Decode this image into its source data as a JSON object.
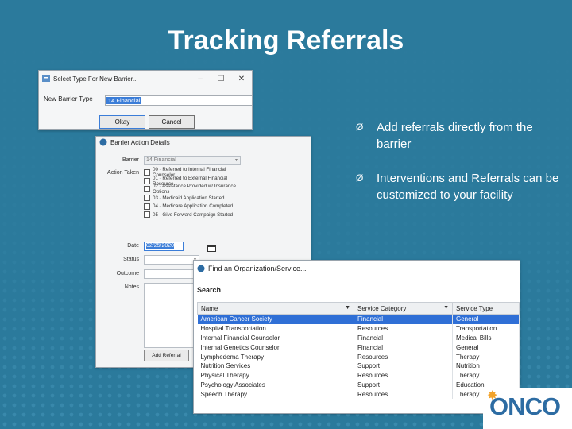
{
  "slide": {
    "title": "Tracking Referrals",
    "bullets": [
      "Add referrals directly from the barrier",
      "Interventions and Referrals can be customized to your facility"
    ],
    "bullet_marker": "Ø"
  },
  "dialog_select_type": {
    "title": "Select Type For New Barrier...",
    "field_label": "New Barrier Type",
    "field_value": "14 Financial",
    "ok_label": "Okay",
    "cancel_label": "Cancel"
  },
  "dialog_barrier_action": {
    "title": "Barrier Action Details",
    "barrier_label": "Barrier",
    "barrier_value": "14 Financial",
    "action_label": "Action Taken",
    "actions": [
      "00 - Referred to Internal Financial Counselor",
      "01 - Referred to External Financial Resource",
      "02 - Assistance Provided w/ Insurance Options",
      "03 - Medicaid Application Started",
      "04 - Medicare Application Completed",
      "05 - Give Forward Campaign Started"
    ],
    "date_label": "Date",
    "date_value": "02/25/2020",
    "status_label": "Status",
    "outcome_label": "Outcome",
    "notes_label": "Notes",
    "add_referral_label": "Add Referral"
  },
  "dialog_find_org": {
    "title": "Find an Organization/Service...",
    "search_label": "Search",
    "columns": [
      "Name",
      "Service Category",
      "Service Type"
    ],
    "rows": [
      [
        "American Cancer Society",
        "Financial",
        "General"
      ],
      [
        "Hospital Transportation",
        "Resources",
        "Transportation"
      ],
      [
        "Internal Financial Counselor",
        "Financial",
        "Medical Bills"
      ],
      [
        "Internal Genetics Counselor",
        "Financial",
        "General"
      ],
      [
        "Lymphedema Therapy",
        "Resources",
        "Therapy"
      ],
      [
        "Nutrition Services",
        "Support",
        "Nutrition"
      ],
      [
        "Physical Therapy",
        "Resources",
        "Therapy"
      ],
      [
        "Psychology Associates",
        "Support",
        "Education"
      ],
      [
        "Speech Therapy",
        "Resources",
        "Therapy"
      ]
    ],
    "selected_row": 0
  },
  "logo": {
    "text": "ONCO"
  },
  "colors": {
    "background": "#2b7a9c",
    "selection": "#2f6fd6"
  }
}
